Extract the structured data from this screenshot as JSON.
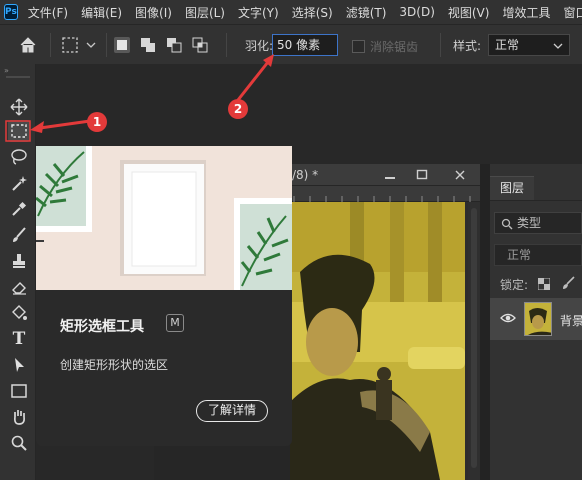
{
  "app": {
    "logo": "Ps"
  },
  "menu": [
    "文件(F)",
    "编辑(E)",
    "图像(I)",
    "图层(L)",
    "文字(Y)",
    "选择(S)",
    "滤镜(T)",
    "3D(D)",
    "视图(V)",
    "增效工具",
    "窗口(W)"
  ],
  "options": {
    "feather_label": "羽化:",
    "feather_value": "50 像素",
    "antialias_label": "消除锯齿",
    "style_label": "样式:",
    "style_value": "正常"
  },
  "tooltip": {
    "title": "矩形选框工具",
    "shortcut": "M",
    "description": "创建矩形形状的选区",
    "learn_more": "了解详情"
  },
  "document": {
    "title_fragment": "/8) *"
  },
  "layers_panel": {
    "tab": "图层",
    "search_placeholder": "类型",
    "blend_mode": "正常",
    "lock_label": "锁定:",
    "layer_name": "背景"
  },
  "callouts": [
    "1",
    "2"
  ],
  "colors": {
    "accent": "#3d74c9",
    "callout": "#e33a3a",
    "photo_tint": "#c9b63a"
  },
  "icons": [
    "home-icon",
    "rect-marquee-icon",
    "move-icon",
    "lasso-icon",
    "magic-wand-icon",
    "eyedropper-icon",
    "brush-icon",
    "stamp-icon",
    "eraser-icon",
    "fill-icon",
    "type-icon",
    "path-select-icon",
    "rectangle-icon",
    "hand-icon",
    "zoom-icon",
    "eye-icon"
  ]
}
